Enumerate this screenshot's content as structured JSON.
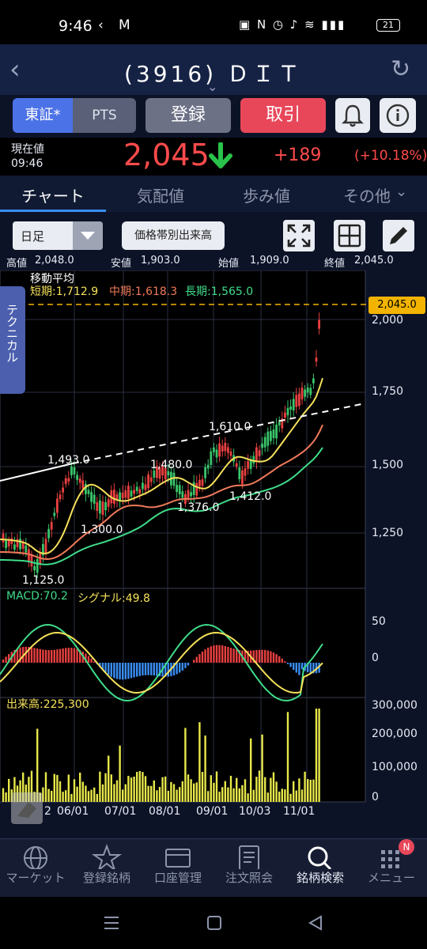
{
  "status_bar": {
    "time": "9:46",
    "battery": "21"
  },
  "header": {
    "title": "(3916) ＤＩＴ"
  },
  "action_row": {
    "tse_label": "東証*",
    "pts_label": "PTS",
    "register_label": "登録",
    "trade_label": "取引"
  },
  "summary": {
    "current_label": "現在値",
    "time": "09:46",
    "price": "2,045",
    "change": "+189",
    "change_pct": "(+10.18%)",
    "colors": {
      "price": "#ff4b4b",
      "arrow": "#29c24a"
    }
  },
  "tabs": [
    "チャート",
    "気配値",
    "歩み値",
    "その他"
  ],
  "toolbar": {
    "period": "日足",
    "volume_button": "価格帯別出来高"
  },
  "ohlc": {
    "high_label": "高値",
    "high": "2,048.0",
    "low_label": "安値",
    "low": "1,903.0",
    "open_label": "始値",
    "open": "1,909.0",
    "close_label": "終値",
    "close": "2,045.0"
  },
  "chart": {
    "ma_title": "移動平均",
    "ma_short": "短期:1,712.9",
    "ma_mid": "中期:1,618.3",
    "ma_long": "長期:1,565.0",
    "side_tab": "テクニカル",
    "current_tag": "2,045.0",
    "price_ticks": [
      "2,000",
      "1,750",
      "1,500",
      "1,250"
    ],
    "annotations": [
      "1,493.0",
      "1,300.0",
      "1,480.0",
      "1,376.0",
      "1,610.0",
      "1,412.0",
      "1,125.0"
    ],
    "macd_label": "MACD:70.2",
    "signal_label": "シグナル:49.8",
    "macd_ticks": [
      "50",
      "0"
    ],
    "volume_label": "出来高:225,300",
    "volume_ticks": [
      "300,000",
      "200,000",
      "100,000",
      "0"
    ],
    "x_ticks": [
      "2",
      "06/01",
      "07/01",
      "08/01",
      "09/01",
      "10/03",
      "11/01"
    ],
    "colors": {
      "short": "#f5e15a",
      "mid": "#f07a5a",
      "long": "#3fdc8a",
      "up": "#e84040",
      "down": "#39c46a",
      "volume": "#e8e84a",
      "tag": "#f2b400"
    }
  },
  "nav": [
    {
      "label": "マーケット",
      "icon": "globe-icon"
    },
    {
      "label": "登録銘柄",
      "icon": "star-icon"
    },
    {
      "label": "口座管理",
      "icon": "card-icon"
    },
    {
      "label": "注文照会",
      "icon": "document-icon"
    },
    {
      "label": "銘柄検索",
      "icon": "search-icon"
    },
    {
      "label": "メニュー",
      "icon": "menu-dots-icon"
    }
  ],
  "nav_badge": "N"
}
